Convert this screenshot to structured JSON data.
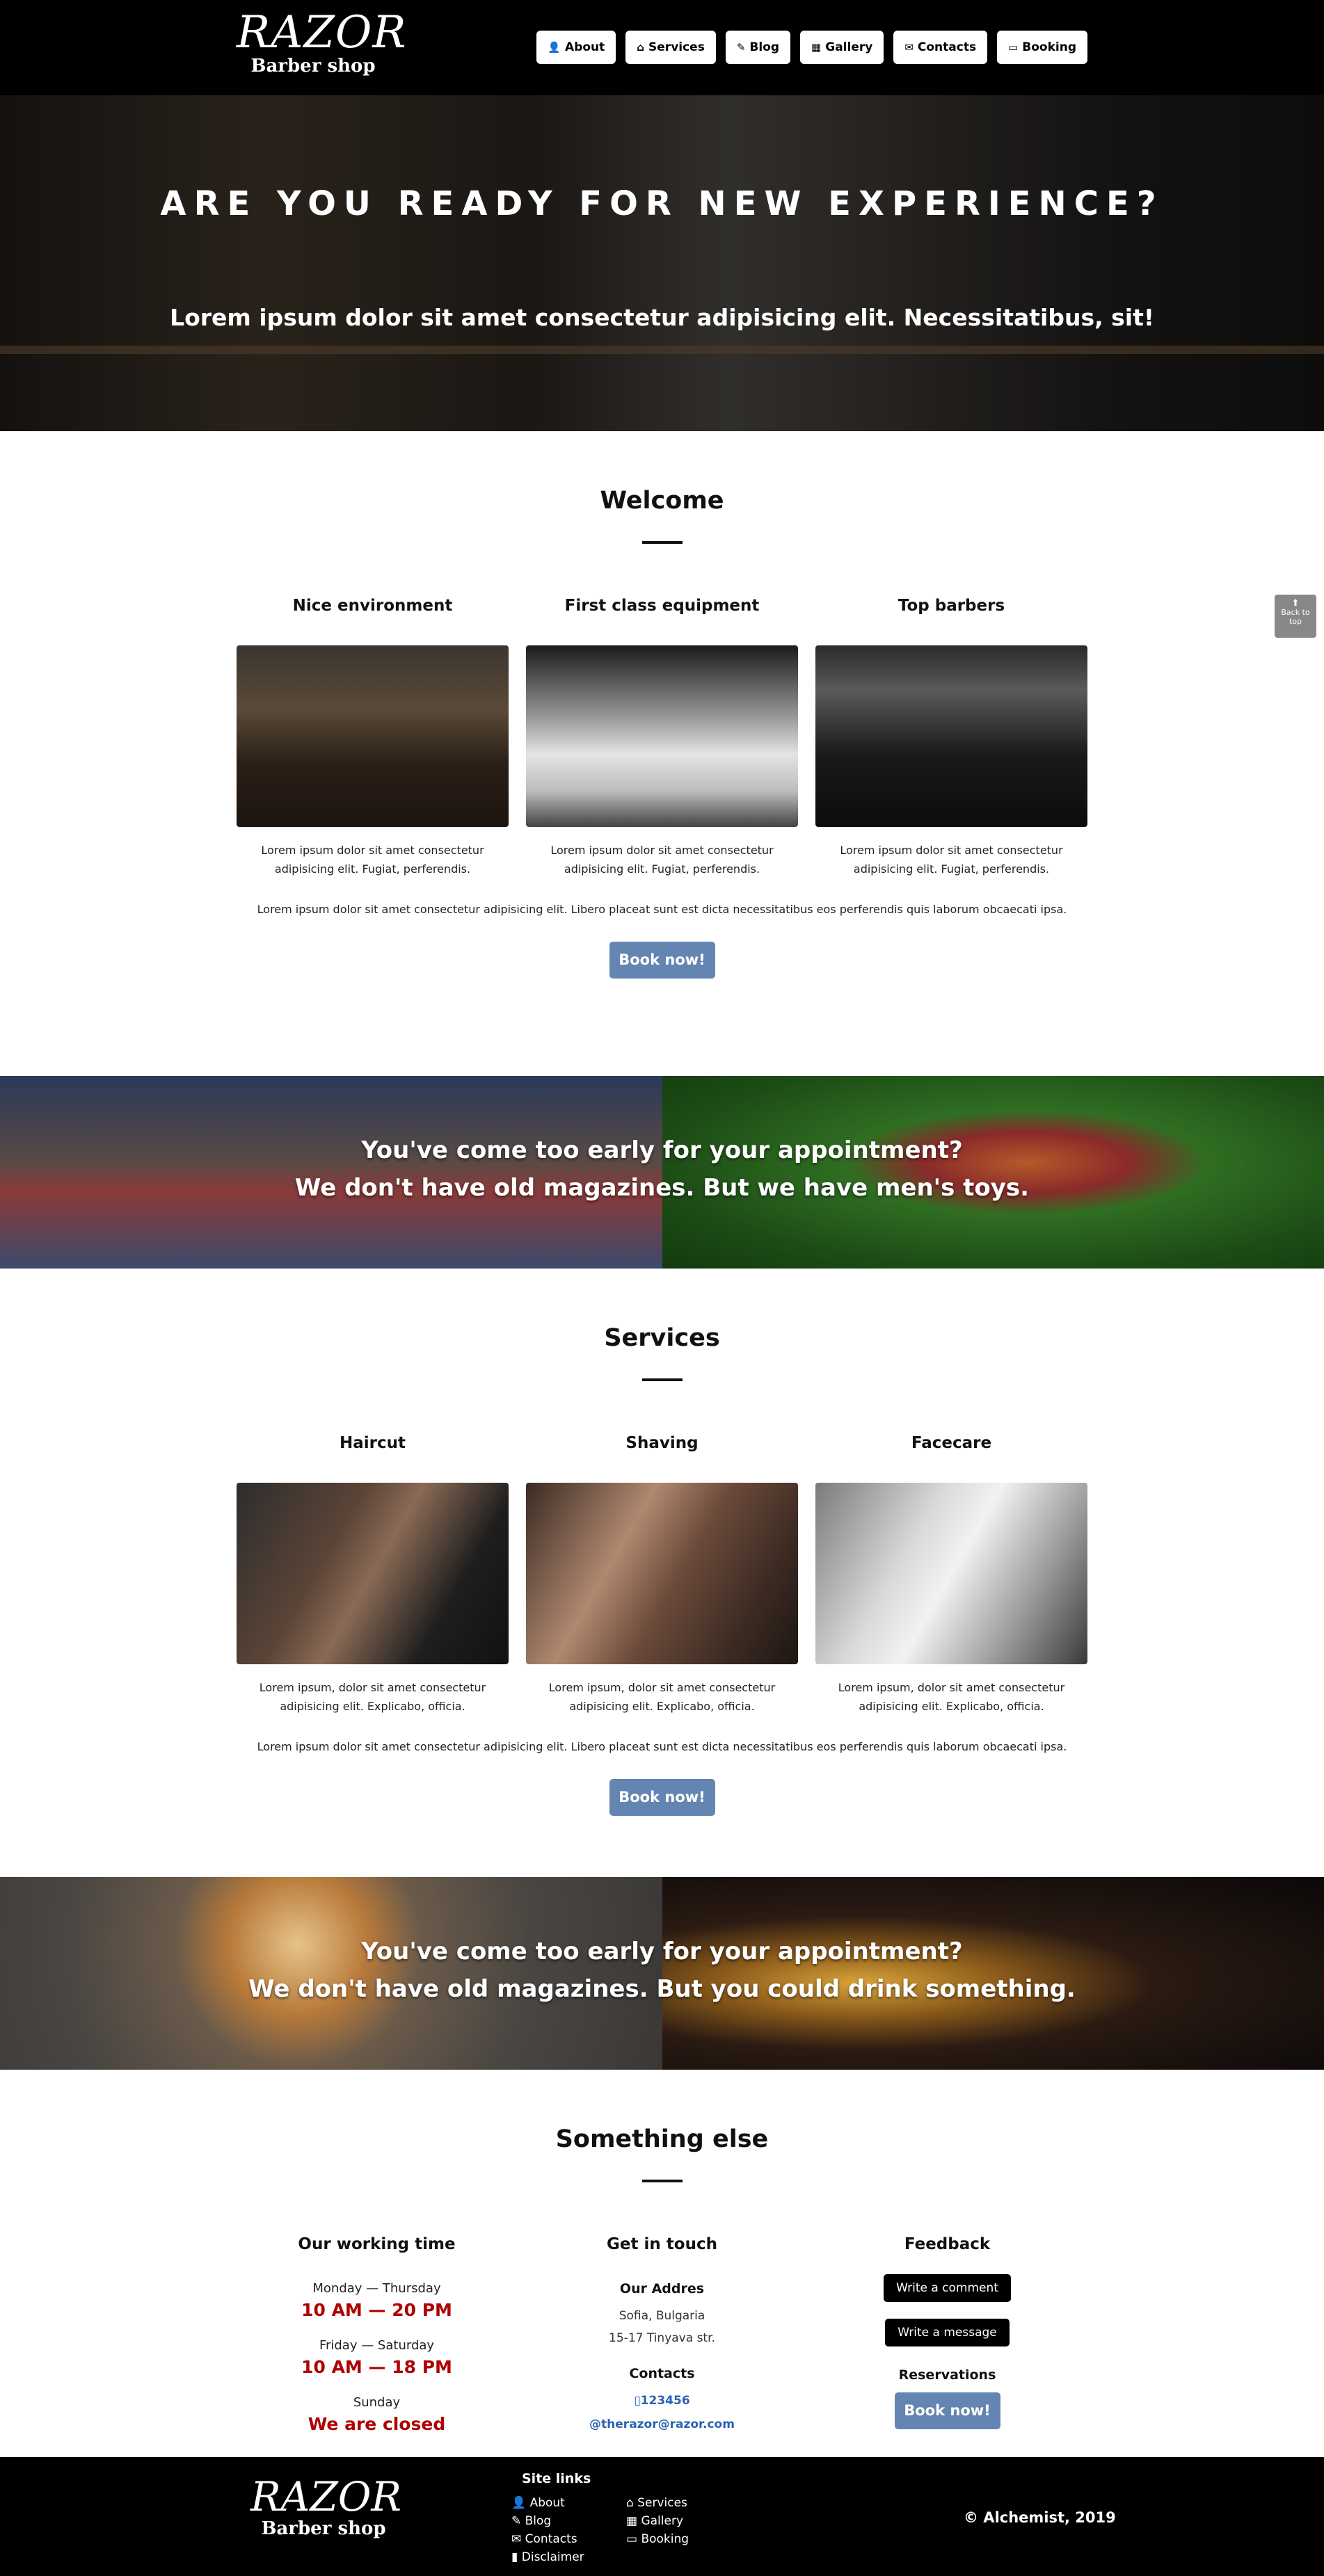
{
  "brand": {
    "logo": "RAZOR",
    "sub": "Barber shop"
  },
  "nav": [
    {
      "icon": "user-icon",
      "glyph": "👤",
      "label": "About"
    },
    {
      "icon": "shop-icon",
      "glyph": "⌂",
      "label": "Services"
    },
    {
      "icon": "blog-icon",
      "glyph": "✎",
      "label": "Blog"
    },
    {
      "icon": "gallery-icon",
      "glyph": "▦",
      "label": "Gallery"
    },
    {
      "icon": "contacts-icon",
      "glyph": "✉",
      "label": "Contacts"
    },
    {
      "icon": "booking-icon",
      "glyph": "▭",
      "label": "Booking"
    }
  ],
  "hero": {
    "title": "ARE YOU READY FOR NEW EXPERIENCE?",
    "subtitle": "Lorem ipsum dolor sit amet consectetur adipisicing elit. Necessitatibus, sit!"
  },
  "welcome": {
    "title": "Welcome",
    "cards": [
      {
        "title": "Nice environment",
        "text": "Lorem ipsum dolor sit amet consectetur adipisicing elit. Fugiat, perferendis."
      },
      {
        "title": "First class equipment",
        "text": "Lorem ipsum dolor sit amet consectetur adipisicing elit. Fugiat, perferendis."
      },
      {
        "title": "Top barbers",
        "text": "Lorem ipsum dolor sit amet consectetur adipisicing elit. Fugiat, perferendis."
      }
    ],
    "wide": "Lorem ipsum dolor sit amet consectetur adipisicing elit. Libero placeat sunt est dicta necessitatibus eos perferendis quis laborum obcaecati ipsa.",
    "button": "Book now!"
  },
  "band1": {
    "line1": "You've come too early for your appointment?",
    "line2": "We don't have old magazines. But we have men's toys."
  },
  "services": {
    "title": "Services",
    "cards": [
      {
        "title": "Haircut",
        "text": "Lorem ipsum, dolor sit amet consectetur adipisicing elit. Explicabo, officia."
      },
      {
        "title": "Shaving",
        "text": "Lorem ipsum, dolor sit amet consectetur adipisicing elit. Explicabo, officia."
      },
      {
        "title": "Facecare",
        "text": "Lorem ipsum, dolor sit amet consectetur adipisicing elit. Explicabo, officia."
      }
    ],
    "wide": "Lorem ipsum dolor sit amet consectetur adipisicing elit. Libero placeat sunt est dicta necessitatibus eos perferendis quis laborum obcaecati ipsa.",
    "button": "Book now!"
  },
  "band2": {
    "line1": "You've come too early for your appointment?",
    "line2": "We don't have old magazines. But you could drink something."
  },
  "else": {
    "title": "Something else",
    "working": {
      "title": "Our working time",
      "d1": "Monday — Thursday",
      "t1": "10 AM — 20 PM",
      "d2": "Friday — Saturday",
      "t2": "10 AM — 18 PM",
      "d3": "Sunday",
      "t3": "We are closed"
    },
    "touch": {
      "title": "Get in touch",
      "addr_title": "Our Addres",
      "addr1": "Sofia, Bulgaria",
      "addr2": "15-17 Tinyava str.",
      "contacts_title": "Contacts",
      "phone": "▯123456",
      "email": "@therazor@razor.com"
    },
    "feedback": {
      "title": "Feedback",
      "comment": "Write a comment",
      "message": "Write a message",
      "res_title": "Reservations",
      "book": "Book now!"
    }
  },
  "footer": {
    "logo": "RAZOR",
    "sub": "Barber shop",
    "links_title": "Site links",
    "links": [
      "👤 About",
      "⌂ Services",
      "✎ Blog",
      "▦ Gallery",
      "✉ Contacts",
      "▭ Booking",
      "▮ Disclaimer"
    ],
    "copyright": "© Alchemist, 2019"
  },
  "backtop": {
    "arrow": "⬆",
    "label": "Back to top"
  }
}
